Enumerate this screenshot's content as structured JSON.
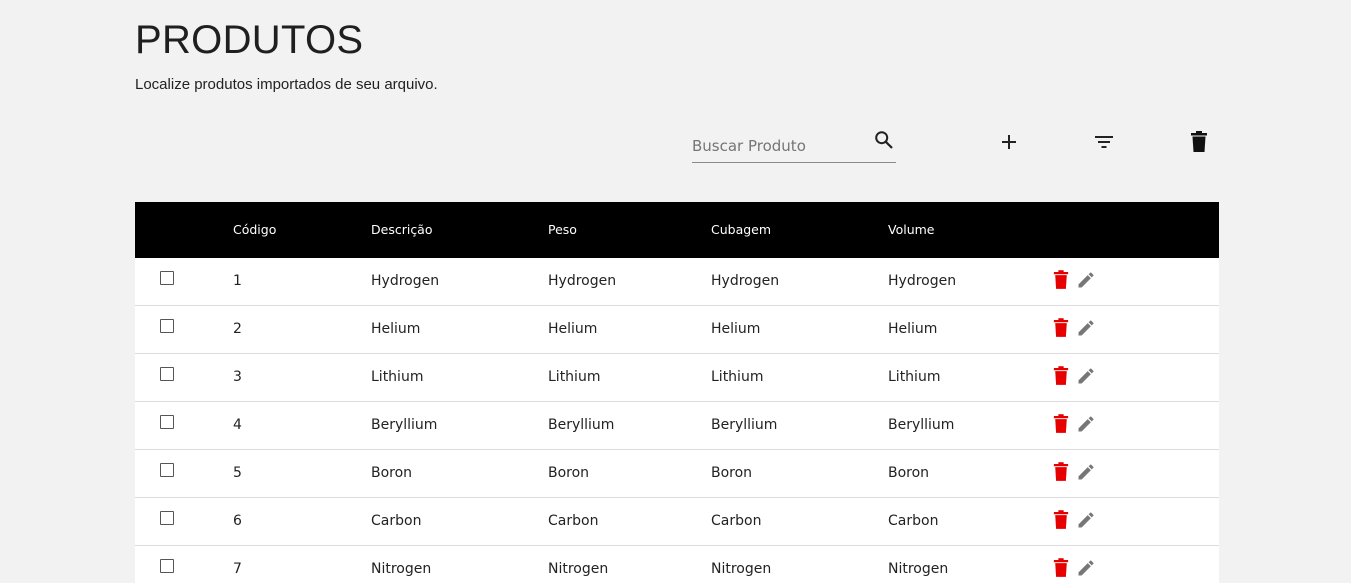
{
  "header": {
    "title": "PRODUTOS",
    "subtitle": "Localize produtos importados de seu arquivo."
  },
  "toolbar": {
    "search_placeholder": "Buscar Produto",
    "search_value": "",
    "icons": [
      "search-icon",
      "add-icon",
      "filter-icon",
      "delete-icon"
    ]
  },
  "table": {
    "columns": [
      "Código",
      "Descrição",
      "Peso",
      "Cubagem",
      "Volume"
    ],
    "rows": [
      {
        "codigo": "1",
        "descricao": "Hydrogen",
        "peso": "Hydrogen",
        "cubagem": "Hydrogen",
        "volume": "Hydrogen"
      },
      {
        "codigo": "2",
        "descricao": "Helium",
        "peso": "Helium",
        "cubagem": "Helium",
        "volume": "Helium"
      },
      {
        "codigo": "3",
        "descricao": "Lithium",
        "peso": "Lithium",
        "cubagem": "Lithium",
        "volume": "Lithium"
      },
      {
        "codigo": "4",
        "descricao": "Beryllium",
        "peso": "Beryllium",
        "cubagem": "Beryllium",
        "volume": "Beryllium"
      },
      {
        "codigo": "5",
        "descricao": "Boron",
        "peso": "Boron",
        "cubagem": "Boron",
        "volume": "Boron"
      },
      {
        "codigo": "6",
        "descricao": "Carbon",
        "peso": "Carbon",
        "cubagem": "Carbon",
        "volume": "Carbon"
      },
      {
        "codigo": "7",
        "descricao": "Nitrogen",
        "peso": "Nitrogen",
        "cubagem": "Nitrogen",
        "volume": "Nitrogen"
      }
    ]
  },
  "colors": {
    "background": "#f2f2f2",
    "header_bg": "#000000",
    "delete_red": "#e60000",
    "edit_gray": "#777777"
  }
}
